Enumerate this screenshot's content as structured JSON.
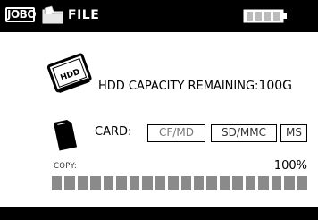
{
  "header": {
    "logo_text": "JOBO",
    "section_label": "FILE",
    "battery_level": 1.0
  },
  "hdd": {
    "label": "HDD CAPACITY REMAINING:",
    "value": "100G",
    "icon_label": "HDD"
  },
  "card": {
    "label": "CARD:",
    "types": [
      "CF/MD",
      "SD/MMC",
      "MS"
    ]
  },
  "copy": {
    "label": "COPY:",
    "percent": "100%",
    "progress": 1.0
  },
  "icons": [
    "jobo-logo",
    "file-folder-icon",
    "battery-icon",
    "hdd-icon",
    "memory-card-icon"
  ],
  "colors": {
    "background": "#000000",
    "panel": "#ffffff",
    "progress_fill": "#8a8a8a"
  }
}
